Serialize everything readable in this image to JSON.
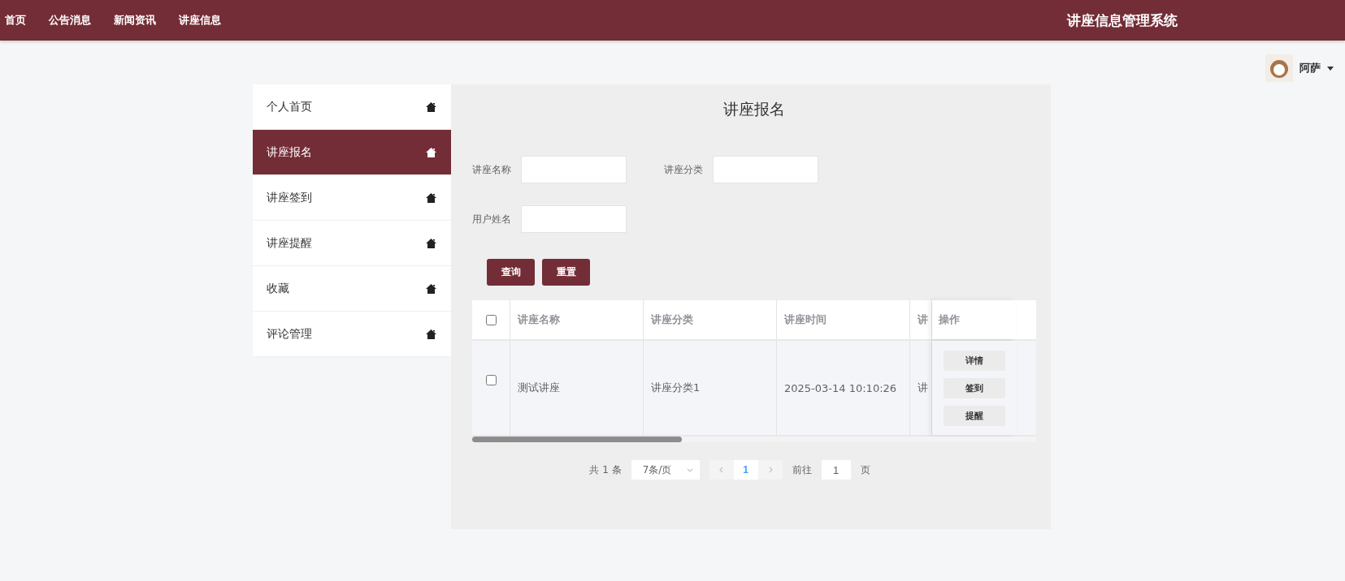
{
  "nav": [
    {
      "label": "首页",
      "selected": false
    },
    {
      "label": "公告消息",
      "selected": false
    },
    {
      "label": "新闻资讯",
      "selected": false
    },
    {
      "label": "讲座信息",
      "selected": false
    }
  ],
  "site_title": "讲座信息管理系统",
  "user": {
    "name": "阿萨"
  },
  "sidebar": {
    "items": [
      {
        "label": "个人首页",
        "selected": false
      },
      {
        "label": "讲座报名",
        "selected": true
      },
      {
        "label": "讲座签到",
        "selected": false
      },
      {
        "label": "讲座提醒",
        "selected": false
      },
      {
        "label": "收藏",
        "selected": false
      },
      {
        "label": "评论管理",
        "selected": false
      }
    ]
  },
  "page_title": "讲座报名",
  "filters": [
    [
      {
        "label": "讲座名称"
      },
      {
        "label": "讲座分类"
      }
    ],
    [
      {
        "label": "用户姓名"
      }
    ]
  ],
  "buttons": [
    {
      "label": "查询"
    },
    {
      "label": "重置"
    }
  ],
  "table": {
    "columns": [
      "讲座名称",
      "讲座分类",
      "讲座时间",
      "讲"
    ],
    "actions_column": "操作",
    "header_checked": false,
    "rows": [
      {
        "checked": false,
        "cells": [
          "测试讲座",
          "讲座分类1",
          "2025-03-14 10:10:26",
          "讲"
        ],
        "actions": [
          "详情",
          "签到",
          "提醒"
        ]
      }
    ]
  },
  "pagination": {
    "total": "共 1 条",
    "page_size": "7条/页",
    "pages": [
      {
        "label": "1",
        "selected": true
      }
    ],
    "goto_label": "前往",
    "goto_value": "1",
    "goto_suffix": "页"
  }
}
